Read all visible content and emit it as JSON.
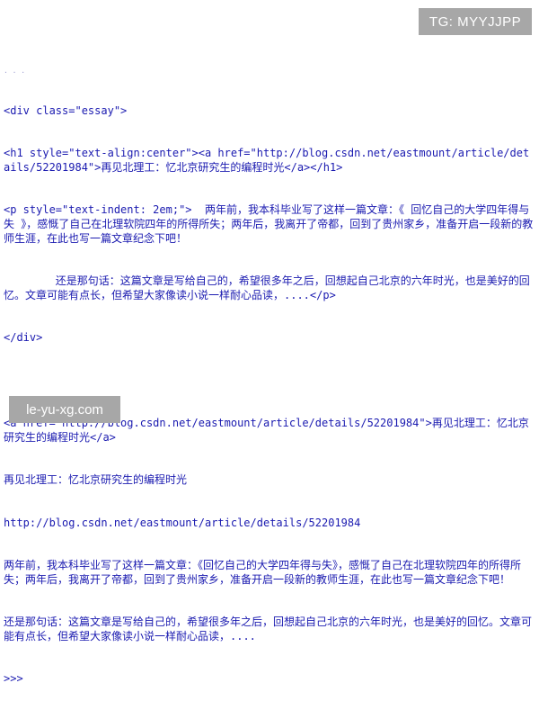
{
  "watermarks": {
    "top_right": "TG: MYYJJPP",
    "bottom_left": "le-yu-xg.com"
  },
  "console": {
    "output_block_1": [
      "<div class=\"essay\">",
      "<h1 style=\"text-align:center\"><a href=\"http://blog.csdn.net/eastmount/article/details/52201984\">再见北理工：忆北京研究生的编程时光</a></h1>",
      "<p style=\"text-indent: 2em;\">  两年前，我本科毕业写了这样一篇文章：《 回忆自己的大学四年得与失 》，感慨了自己在北理软院四年的所得所失；两年后，我离开了帝都，回到了贵州家乡，准备开启一段新的教师生涯，在此也写一篇文章纪念下吧！",
      "        还是那句话：这篇文章是写给自己的，希望很多年之后，回想起自己北京的六年时光，也是美好的回忆。文章可能有点长，但希望大家像读小说一样耐心品读，....</p>",
      "</div>"
    ],
    "output_block_2": [
      "<a href=\"http://blog.csdn.net/eastmount/article/details/52201984\">再见北理工：忆北京研究生的编程时光</a>",
      "再见北理工：忆北京研究生的编程时光",
      "http://blog.csdn.net/eastmount/article/details/52201984",
      "两年前，我本科毕业写了这样一篇文章：《回忆自己的大学四年得与失》，感慨了自己在北理软院四年的所得所失；两年后，我离开了帝都，回到了贵州家乡，准备开启一段新的教师生涯，在此也写一篇文章纪念下吧！",
      "还是那句话：这篇文章是写给自己的，希望很多年之后，回想起自己北京的六年时光，也是美好的回忆。文章可能有点长，但希望大家像读小说一样耐心品读，...."
    ],
    "prompt": ">>>"
  }
}
